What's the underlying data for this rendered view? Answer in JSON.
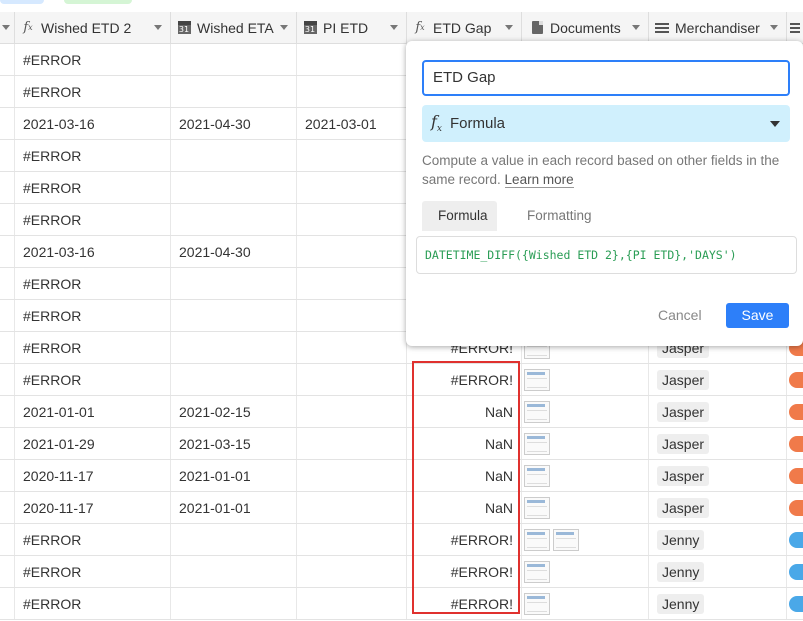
{
  "columns": [
    {
      "label": "Wished ETD 2",
      "icon": "formula-icon"
    },
    {
      "label": "Wished ETA",
      "icon": "calendar-icon"
    },
    {
      "label": "PI ETD",
      "icon": "calendar-icon"
    },
    {
      "label": "ETD Gap",
      "icon": "formula-icon"
    },
    {
      "label": "Documents",
      "icon": "document-icon"
    },
    {
      "label": "Merchandiser",
      "icon": "link-icon"
    }
  ],
  "rows": [
    {
      "etd2": "#ERROR",
      "eta": "",
      "pi": "",
      "gap": "",
      "docs": 0,
      "merch": "",
      "avatar": ""
    },
    {
      "etd2": "#ERROR",
      "eta": "",
      "pi": "",
      "gap": "",
      "docs": 0,
      "merch": "",
      "avatar": ""
    },
    {
      "etd2": "2021-03-16",
      "eta": "2021-04-30",
      "pi": "2021-03-01",
      "gap": "",
      "docs": 0,
      "merch": "",
      "avatar": ""
    },
    {
      "etd2": "#ERROR",
      "eta": "",
      "pi": "",
      "gap": "",
      "docs": 0,
      "merch": "",
      "avatar": ""
    },
    {
      "etd2": "#ERROR",
      "eta": "",
      "pi": "",
      "gap": "",
      "docs": 0,
      "merch": "",
      "avatar": ""
    },
    {
      "etd2": "#ERROR",
      "eta": "",
      "pi": "",
      "gap": "",
      "docs": 0,
      "merch": "",
      "avatar": ""
    },
    {
      "etd2": "2021-03-16",
      "eta": "2021-04-30",
      "pi": "",
      "gap": "",
      "docs": 0,
      "merch": "",
      "avatar": ""
    },
    {
      "etd2": "#ERROR",
      "eta": "",
      "pi": "",
      "gap": "",
      "docs": 0,
      "merch": "",
      "avatar": ""
    },
    {
      "etd2": "#ERROR",
      "eta": "",
      "pi": "",
      "gap": "",
      "docs": 0,
      "merch": "",
      "avatar": ""
    },
    {
      "etd2": "#ERROR",
      "eta": "",
      "pi": "",
      "gap": "#ERROR!",
      "docs": 1,
      "merch": "Jasper",
      "avatar": "#f07a4a"
    },
    {
      "etd2": "#ERROR",
      "eta": "",
      "pi": "",
      "gap": "#ERROR!",
      "docs": 1,
      "merch": "Jasper",
      "avatar": "#f07a4a"
    },
    {
      "etd2": "2021-01-01",
      "eta": "2021-02-15",
      "pi": "",
      "gap": "NaN",
      "docs": 1,
      "merch": "Jasper",
      "avatar": "#f07a4a"
    },
    {
      "etd2": "2021-01-29",
      "eta": "2021-03-15",
      "pi": "",
      "gap": "NaN",
      "docs": 1,
      "merch": "Jasper",
      "avatar": "#f07a4a"
    },
    {
      "etd2": "2020-11-17",
      "eta": "2021-01-01",
      "pi": "",
      "gap": "NaN",
      "docs": 1,
      "merch": "Jasper",
      "avatar": "#f07a4a"
    },
    {
      "etd2": "2020-11-17",
      "eta": "2021-01-01",
      "pi": "",
      "gap": "NaN",
      "docs": 1,
      "merch": "Jasper",
      "avatar": "#f07a4a"
    },
    {
      "etd2": "#ERROR",
      "eta": "",
      "pi": "",
      "gap": "#ERROR!",
      "docs": 2,
      "merch": "Jenny",
      "avatar": "#4aa8e8"
    },
    {
      "etd2": "#ERROR",
      "eta": "",
      "pi": "",
      "gap": "#ERROR!",
      "docs": 1,
      "merch": "Jenny",
      "avatar": "#4aa8e8"
    },
    {
      "etd2": "#ERROR",
      "eta": "",
      "pi": "",
      "gap": "#ERROR!",
      "docs": 1,
      "merch": "Jenny",
      "avatar": "#4aa8e8"
    }
  ],
  "popup": {
    "field_name": "ETD Gap",
    "field_type": "Formula",
    "description": "Compute a value in each record based on other fields in the same record.",
    "learn_more": "Learn more",
    "tabs": [
      "Formula",
      "Formatting"
    ],
    "formula": "DATETIME_DIFF({Wished ETD 2},{PI ETD},'DAYS')",
    "cancel": "Cancel",
    "save": "Save"
  },
  "colors": {
    "accent": "#2d7ff9",
    "highlight_box": "#e0312e",
    "type_bg": "#d0f0fd"
  }
}
